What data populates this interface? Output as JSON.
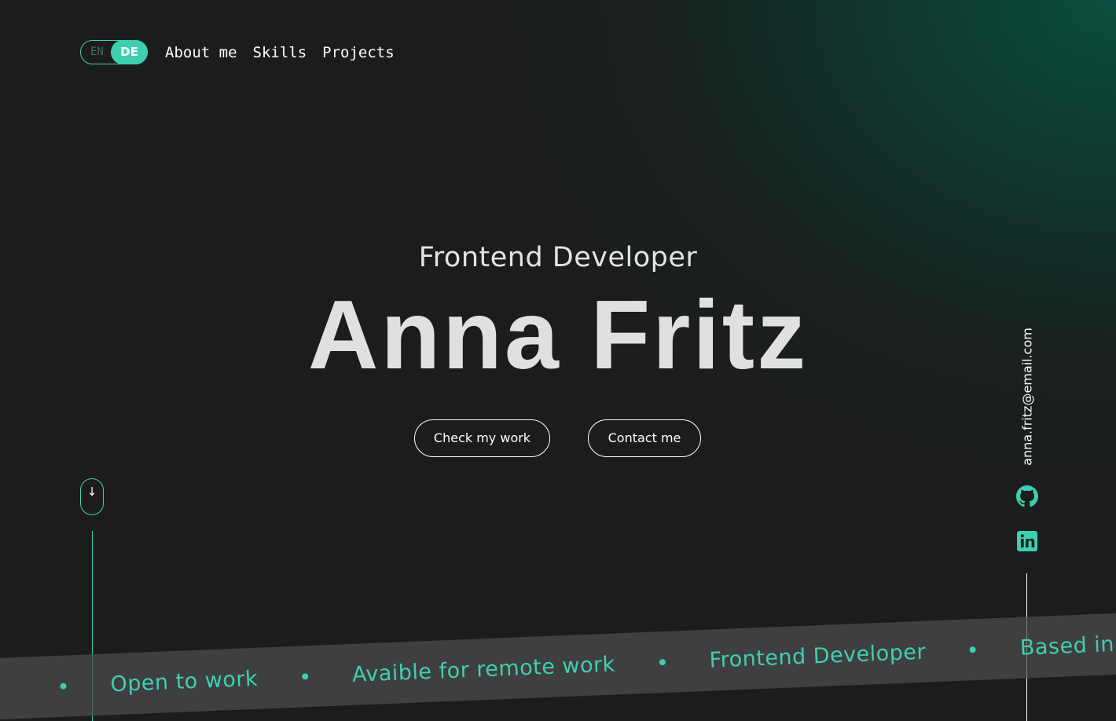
{
  "header": {
    "lang_toggle": {
      "options": [
        "EN",
        "DE"
      ],
      "active": "DE"
    },
    "nav": [
      "About me",
      "Skills",
      "Projects"
    ]
  },
  "hero": {
    "subtitle": "Frontend Developer",
    "name": "Anna Fritz",
    "buttons": {
      "work": "Check my work",
      "contact": "Contact me"
    }
  },
  "scroll": {
    "icon": "arrow-down-icon",
    "glyph": "↓"
  },
  "socials": {
    "email": "anna.fritz@email.com",
    "icons": [
      "github-icon",
      "linkedin-icon"
    ]
  },
  "marquee": {
    "items": [
      "Open to work",
      "Avaible for remote work",
      "Frontend Developer",
      "Based in Laufe"
    ]
  },
  "colors": {
    "accent": "#3ecfb0",
    "background": "#1c1c1c",
    "gradient": "#0a5040",
    "text": "#ffffff"
  }
}
